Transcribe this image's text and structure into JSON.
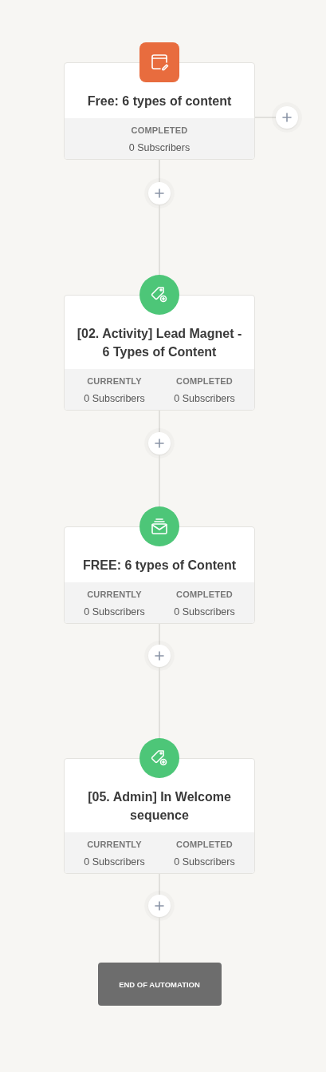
{
  "steps": [
    {
      "kind": "form",
      "title": "Free: 6 types of content",
      "side_add": true,
      "stats": [
        {
          "label": "COMPLETED",
          "value": "0 Subscribers"
        }
      ]
    },
    {
      "kind": "tag",
      "title": "[02. Activity] Lead Magnet - 6 Types of Content",
      "side_add": false,
      "stats": [
        {
          "label": "CURRENTLY",
          "value": "0 Subscribers"
        },
        {
          "label": "COMPLETED",
          "value": "0 Subscribers"
        }
      ]
    },
    {
      "kind": "email",
      "title": "FREE: 6 types of Content",
      "side_add": false,
      "stats": [
        {
          "label": "CURRENTLY",
          "value": "0 Subscribers"
        },
        {
          "label": "COMPLETED",
          "value": "0 Subscribers"
        }
      ]
    },
    {
      "kind": "tag",
      "title": "[05. Admin] In Welcome sequence",
      "side_add": false,
      "stats": [
        {
          "label": "CURRENTLY",
          "value": "0 Subscribers"
        },
        {
          "label": "COMPLETED",
          "value": "0 Subscribers"
        }
      ]
    }
  ],
  "end": {
    "label": "END OF AUTOMATION"
  }
}
